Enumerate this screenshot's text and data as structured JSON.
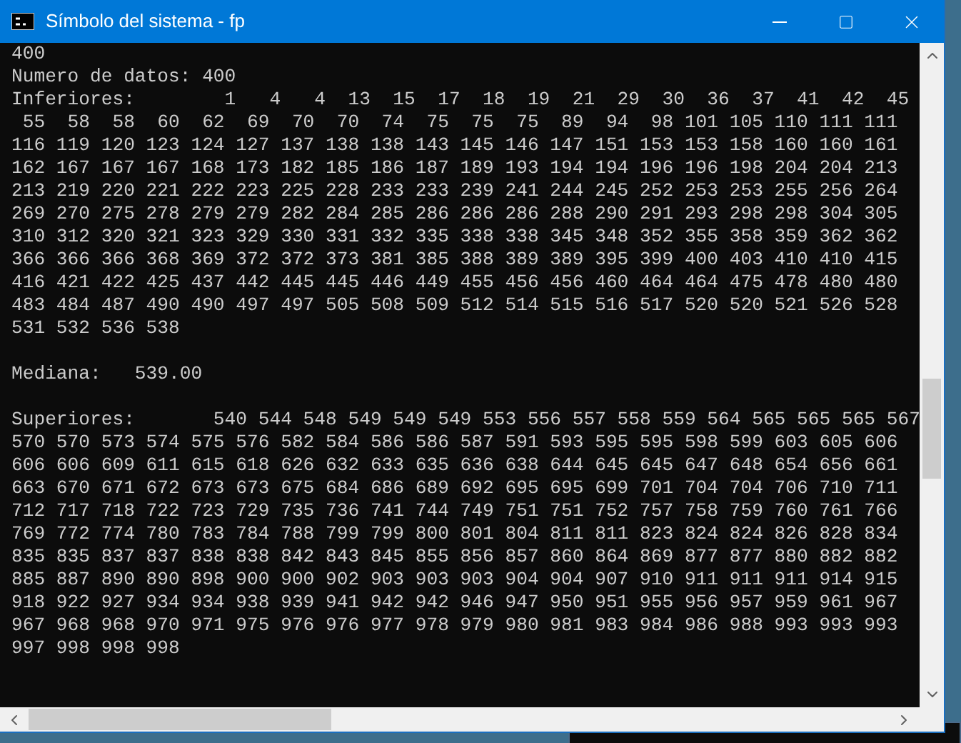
{
  "window": {
    "title": "Símbolo del sistema - fp"
  },
  "console": {
    "blocks": [
      {
        "lines": [
          "400",
          "Numero de datos: 400",
          "Inferiores:        1   4   4  13  15  17  18  19  21  29  30  36  37  41  42  45",
          " 55  58  58  60  62  69  70  70  74  75  75  75  89  94  98 101 105 110 111 111",
          "116 119 120 123 124 127 137 138 138 143 145 146 147 151 153 153 158 160 160 161",
          "162 167 167 167 168 173 182 185 186 187 189 193 194 194 196 196 198 204 204 213",
          "213 219 220 221 222 223 225 228 233 233 239 241 244 245 252 253 253 255 256 264",
          "269 270 275 278 279 279 282 284 285 286 286 286 288 290 291 293 298 298 304 305",
          "310 312 320 321 323 329 330 331 332 335 338 338 345 348 352 355 358 359 362 362",
          "366 366 366 368 369 372 372 373 381 385 388 389 389 395 399 400 403 410 410 415",
          "416 421 422 425 437 442 445 445 446 449 455 456 456 460 464 464 475 478 480 480",
          "483 484 487 490 490 497 497 505 508 509 512 514 515 516 517 520 520 521 526 528",
          "531 532 536 538"
        ]
      },
      {
        "lines": [
          "Mediana:   539.00"
        ]
      },
      {
        "lines": [
          "Superiores:       540 544 548 549 549 549 553 556 557 558 559 564 565 565 565 567",
          "570 570 573 574 575 576 582 584 586 586 587 591 593 595 595 598 599 603 605 606",
          "606 606 609 611 615 618 626 632 633 635 636 638 644 645 645 647 648 654 656 661",
          "663 670 671 672 673 673 675 684 686 689 692 695 695 699 701 704 704 706 710 711",
          "712 717 718 722 723 729 735 736 741 744 749 751 751 752 757 758 759 760 761 766",
          "769 772 774 780 783 784 788 799 799 800 801 804 811 811 823 824 824 826 828 834",
          "835 835 837 837 838 838 842 843 845 855 856 857 860 864 869 877 877 880 882 882",
          "885 887 890 890 898 900 900 902 903 903 903 904 904 907 910 911 911 911 914 915",
          "918 922 927 934 934 938 939 941 942 942 946 947 950 951 955 956 957 959 961 967",
          "967 968 968 970 971 975 976 976 977 978 979 980 981 983 984 986 988 993 993 993",
          "997 998 998 998"
        ]
      }
    ]
  }
}
